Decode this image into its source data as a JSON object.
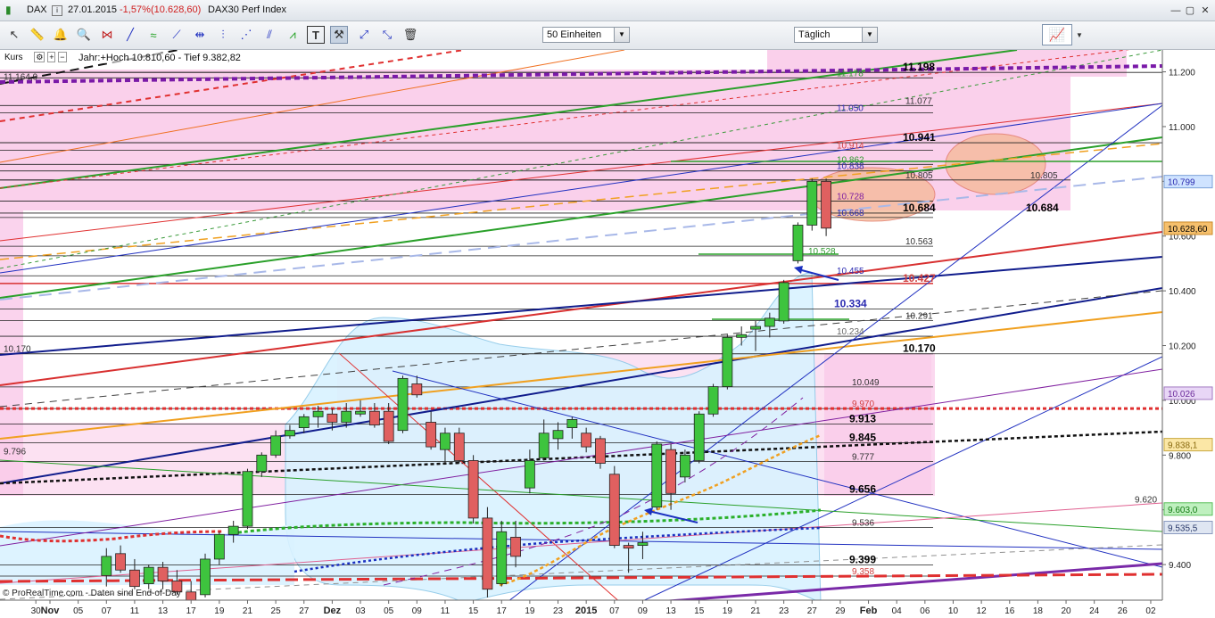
{
  "window": {
    "symbol": "DAX",
    "date": "27.01.2015",
    "change_pct": "-1,57%",
    "last_price": "(10.628,60)",
    "instrument": "DAX30 Perf Index"
  },
  "toolbar": {
    "units_select": "50 Einheiten",
    "interval_select": "Täglich",
    "tools": [
      "cursor-icon",
      "ruler-icon",
      "alert-bell-icon",
      "zoom-icon",
      "fibonacci-icon",
      "line-icon",
      "channel-icon",
      "trendline-icon",
      "horizontal-line-icon",
      "vertical-lines-icon",
      "fan-icon",
      "pitchfork-icon",
      "text-icon",
      "hammer-icon",
      "arrow-expand-icon",
      "arrow-icon",
      "trash-icon"
    ]
  },
  "labels": {
    "kurs": "Kurs",
    "year_range": "Jahr:+Hoch 10.810,60 - Tief 9.382,82",
    "credit": "© ProRealTime.com - Daten sind End-of-Day"
  },
  "colors": {
    "up": "#3ec43e",
    "down": "#e06060",
    "pink_zone": "#f9c8e8",
    "blue_zone": "#d9f2ff",
    "orange_ellipse": "#f5b895"
  },
  "chart_data": {
    "type": "candlestick",
    "ylim": [
      9270,
      11280
    ],
    "y_ticks": [
      9400,
      9600,
      9800,
      10000,
      10200,
      10400,
      10600,
      10800,
      11000,
      11200
    ],
    "y_tick_labels": [
      "9.400",
      "9.600",
      "9.800",
      "10.000",
      "10.200",
      "10.400",
      "10.600",
      "10.800",
      "11.000",
      "11.200"
    ],
    "x_tick_labels": [
      {
        "label": "30",
        "idx": -1
      },
      {
        "label": "Nov",
        "idx": 0,
        "bold": true
      },
      {
        "label": "05",
        "idx": 2
      },
      {
        "label": "07",
        "idx": 4
      },
      {
        "label": "11",
        "idx": 6
      },
      {
        "label": "13",
        "idx": 8
      },
      {
        "label": "17",
        "idx": 10
      },
      {
        "label": "19",
        "idx": 12
      },
      {
        "label": "21",
        "idx": 14
      },
      {
        "label": "25",
        "idx": 16
      },
      {
        "label": "27",
        "idx": 18
      },
      {
        "label": "Dez",
        "idx": 20,
        "bold": true
      },
      {
        "label": "03",
        "idx": 22
      },
      {
        "label": "05",
        "idx": 24
      },
      {
        "label": "09",
        "idx": 26
      },
      {
        "label": "11",
        "idx": 28
      },
      {
        "label": "15",
        "idx": 30
      },
      {
        "label": "17",
        "idx": 32
      },
      {
        "label": "19",
        "idx": 34
      },
      {
        "label": "23",
        "idx": 36
      },
      {
        "label": "2015",
        "idx": 38,
        "bold": true
      },
      {
        "label": "07",
        "idx": 40
      },
      {
        "label": "09",
        "idx": 42
      },
      {
        "label": "13",
        "idx": 44
      },
      {
        "label": "15",
        "idx": 46
      },
      {
        "label": "19",
        "idx": 48
      },
      {
        "label": "21",
        "idx": 50
      },
      {
        "label": "23",
        "idx": 52
      },
      {
        "label": "27",
        "idx": 54
      },
      {
        "label": "29",
        "idx": 56
      },
      {
        "label": "Feb",
        "idx": 58,
        "bold": true
      },
      {
        "label": "04",
        "idx": 60
      },
      {
        "label": "06",
        "idx": 62
      },
      {
        "label": "10",
        "idx": 64
      },
      {
        "label": "12",
        "idx": 66
      },
      {
        "label": "16",
        "idx": 68
      },
      {
        "label": "18",
        "idx": 70
      },
      {
        "label": "20",
        "idx": 72
      },
      {
        "label": "24",
        "idx": 74
      },
      {
        "label": "26",
        "idx": 76
      },
      {
        "label": "02",
        "idx": 78
      }
    ],
    "candles": [
      {
        "o": 9360,
        "h": 9460,
        "l": 9320,
        "c": 9430
      },
      {
        "o": 9440,
        "h": 9470,
        "l": 9370,
        "c": 9380
      },
      {
        "o": 9380,
        "h": 9420,
        "l": 9310,
        "c": 9320
      },
      {
        "o": 9330,
        "h": 9400,
        "l": 9310,
        "c": 9390
      },
      {
        "o": 9390,
        "h": 9410,
        "l": 9310,
        "c": 9340
      },
      {
        "o": 9340,
        "h": 9380,
        "l": 9290,
        "c": 9300
      },
      {
        "o": 9300,
        "h": 9340,
        "l": 9220,
        "c": 9240
      },
      {
        "o": 9290,
        "h": 9440,
        "l": 9280,
        "c": 9420
      },
      {
        "o": 9420,
        "h": 9520,
        "l": 9400,
        "c": 9510
      },
      {
        "o": 9510,
        "h": 9560,
        "l": 9480,
        "c": 9540
      },
      {
        "o": 9540,
        "h": 9750,
        "l": 9530,
        "c": 9740
      },
      {
        "o": 9740,
        "h": 9810,
        "l": 9720,
        "c": 9800
      },
      {
        "o": 9800,
        "h": 9890,
        "l": 9790,
        "c": 9870
      },
      {
        "o": 9870,
        "h": 9910,
        "l": 9860,
        "c": 9890
      },
      {
        "o": 9900,
        "h": 9950,
        "l": 9880,
        "c": 9940
      },
      {
        "o": 9940,
        "h": 9980,
        "l": 9900,
        "c": 9960
      },
      {
        "o": 9950,
        "h": 9970,
        "l": 9890,
        "c": 9920
      },
      {
        "o": 9920,
        "h": 9990,
        "l": 9900,
        "c": 9960
      },
      {
        "o": 9950,
        "h": 10000,
        "l": 9940,
        "c": 9960
      },
      {
        "o": 9960,
        "h": 9990,
        "l": 9900,
        "c": 9910
      },
      {
        "o": 9960,
        "h": 9990,
        "l": 9840,
        "c": 9850
      },
      {
        "o": 9890,
        "h": 10090,
        "l": 9880,
        "c": 10080
      },
      {
        "o": 10060,
        "h": 10090,
        "l": 10010,
        "c": 10020
      },
      {
        "o": 9920,
        "h": 9960,
        "l": 9820,
        "c": 9830
      },
      {
        "o": 9820,
        "h": 9900,
        "l": 9770,
        "c": 9880
      },
      {
        "o": 9880,
        "h": 9900,
        "l": 9770,
        "c": 9780
      },
      {
        "o": 9780,
        "h": 9800,
        "l": 9550,
        "c": 9570
      },
      {
        "o": 9570,
        "h": 9610,
        "l": 9280,
        "c": 9310
      },
      {
        "o": 9330,
        "h": 9560,
        "l": 9320,
        "c": 9520
      },
      {
        "o": 9500,
        "h": 9560,
        "l": 9390,
        "c": 9430
      },
      {
        "o": 9680,
        "h": 9820,
        "l": 9660,
        "c": 9780
      },
      {
        "o": 9790,
        "h": 9930,
        "l": 9780,
        "c": 9880
      },
      {
        "o": 9860,
        "h": 9920,
        "l": 9820,
        "c": 9890
      },
      {
        "o": 9900,
        "h": 9940,
        "l": 9860,
        "c": 9930
      },
      {
        "o": 9880,
        "h": 9900,
        "l": 9810,
        "c": 9830
      },
      {
        "o": 9860,
        "h": 9870,
        "l": 9750,
        "c": 9770
      },
      {
        "o": 9730,
        "h": 9760,
        "l": 9460,
        "c": 9470
      },
      {
        "o": 9470,
        "h": 9480,
        "l": 9370,
        "c": 9460
      },
      {
        "o": 9470,
        "h": 9520,
        "l": 9420,
        "c": 9480
      },
      {
        "o": 9610,
        "h": 9850,
        "l": 9600,
        "c": 9840
      },
      {
        "o": 9820,
        "h": 9840,
        "l": 9600,
        "c": 9660
      },
      {
        "o": 9720,
        "h": 9820,
        "l": 9700,
        "c": 9800
      },
      {
        "o": 9780,
        "h": 9960,
        "l": 9770,
        "c": 9950
      },
      {
        "o": 9950,
        "h": 10060,
        "l": 9940,
        "c": 10050
      },
      {
        "o": 10050,
        "h": 10240,
        "l": 10040,
        "c": 10230
      },
      {
        "o": 10230,
        "h": 10270,
        "l": 10200,
        "c": 10240
      },
      {
        "o": 10260,
        "h": 10290,
        "l": 10180,
        "c": 10270
      },
      {
        "o": 10270,
        "h": 10320,
        "l": 10230,
        "c": 10300
      },
      {
        "o": 10290,
        "h": 10440,
        "l": 10280,
        "c": 10430
      },
      {
        "o": 10510,
        "h": 10650,
        "l": 10500,
        "c": 10640
      },
      {
        "o": 10640,
        "h": 10810,
        "l": 10620,
        "c": 10800
      },
      {
        "o": 10800,
        "h": 10810,
        "l": 10600,
        "c": 10629
      }
    ],
    "first_candle_index": 4,
    "price_labels": [
      {
        "v": 11198,
        "text": "11.198",
        "color": "#000000",
        "bold": true,
        "x": 1012
      },
      {
        "v": 11178,
        "text": "11.178",
        "color": "#2e9a2e",
        "x": 938
      },
      {
        "v": 11077,
        "text": "11.077",
        "color": "#333333",
        "x": 1015
      },
      {
        "v": 11050,
        "text": "11.050",
        "color": "#2a2ab0",
        "x": 938
      },
      {
        "v": 10941,
        "text": "10.941",
        "color": "#000000",
        "bold": true,
        "x": 1012
      },
      {
        "v": 10914,
        "text": "10.914",
        "color": "#d04040",
        "x": 938
      },
      {
        "v": 10862,
        "text": "10.862",
        "color": "#2e9a2e",
        "x": 938
      },
      {
        "v": 10838,
        "text": "10.838",
        "color": "#2a2ab0",
        "x": 938
      },
      {
        "v": 10805,
        "text": "10.805",
        "color": "#333333",
        "x": 1015
      },
      {
        "v": 10805,
        "text": "10.805",
        "color": "#333333",
        "x": 1155
      },
      {
        "v": 10728,
        "text": "10.728",
        "color": "#8020a0",
        "x": 938
      },
      {
        "v": 10684,
        "text": "10.684",
        "color": "#000000",
        "bold": true,
        "x": 1012
      },
      {
        "v": 10684,
        "text": "10.684",
        "color": "#000000",
        "bold": true,
        "x": 1150
      },
      {
        "v": 10668,
        "text": "10.668",
        "color": "#2a2ab0",
        "x": 938
      },
      {
        "v": 10563,
        "text": "10.563",
        "color": "#333333",
        "x": 1015
      },
      {
        "v": 10528,
        "text": "10.528",
        "color": "#2e9a2e",
        "x": 906
      },
      {
        "v": 10455,
        "text": "10.455",
        "color": "#2a2ab0",
        "x": 938
      },
      {
        "v": 10427,
        "text": "10.427",
        "color": "#d04040",
        "bold": true,
        "x": 1012
      },
      {
        "v": 10334,
        "text": "10.334",
        "color": "#2a2ab0",
        "bold": true,
        "x": 935
      },
      {
        "v": 10291,
        "text": "10.291",
        "color": "#333333",
        "x": 1015
      },
      {
        "v": 10234,
        "text": "10.234",
        "color": "#666666",
        "x": 938
      },
      {
        "v": 10170,
        "text": "10.170",
        "color": "#000000",
        "bold": true,
        "x": 1012
      },
      {
        "v": 10170,
        "text": "10.170",
        "color": "#333333",
        "x": 4
      },
      {
        "v": 10049,
        "text": "10.049",
        "color": "#333333",
        "x": 955
      },
      {
        "v": 9970,
        "text": "9.970",
        "color": "#d04040",
        "x": 955
      },
      {
        "v": 9913,
        "text": "9.913",
        "color": "#000000",
        "bold": true,
        "x": 952
      },
      {
        "v": 9845,
        "text": "9.845",
        "color": "#000000",
        "bold": true,
        "x": 952
      },
      {
        "v": 9796,
        "text": "9.796",
        "color": "#333333",
        "x": 4
      },
      {
        "v": 9777,
        "text": "9.777",
        "color": "#333333",
        "x": 955
      },
      {
        "v": 9656,
        "text": "9.656",
        "color": "#000000",
        "bold": true,
        "x": 952
      },
      {
        "v": 9620,
        "text": "9.620",
        "color": "#333333",
        "x": 1272
      },
      {
        "v": 9536,
        "text": "9.536",
        "color": "#333333",
        "x": 955
      },
      {
        "v": 9399,
        "text": "9.399",
        "color": "#000000",
        "bold": true,
        "x": 952
      },
      {
        "v": 9358,
        "text": "9.358",
        "color": "#d04040",
        "x": 955
      },
      {
        "v": 11165,
        "text": "11.164,9",
        "color": "#333333",
        "x": 4
      }
    ],
    "right_badges": [
      {
        "v": 10799,
        "text": "10.799",
        "bg": "#cfe3ff",
        "fg": "#2a2ab0",
        "border": "#7aa0d8"
      },
      {
        "v": 10628.6,
        "text": "10.628,60",
        "bg": "#f6c06c",
        "fg": "#000000",
        "border": "#c98a2a"
      },
      {
        "v": 10026,
        "text": "10.026",
        "bg": "#e8d6f6",
        "fg": "#6a2a9a",
        "border": "#a27ac2"
      },
      {
        "v": 9838.1,
        "text": "9.838,1",
        "bg": "#fbe7a6",
        "fg": "#8a6a10",
        "border": "#c9a840"
      },
      {
        "v": 9603,
        "text": "9.603,0",
        "bg": "#bff0bf",
        "fg": "#127a12",
        "border": "#5abf5a"
      },
      {
        "v": 9535.5,
        "text": "9.535,5",
        "bg": "#dfe6f2",
        "fg": "#2a3a6a",
        "border": "#8a9abf"
      }
    ]
  }
}
